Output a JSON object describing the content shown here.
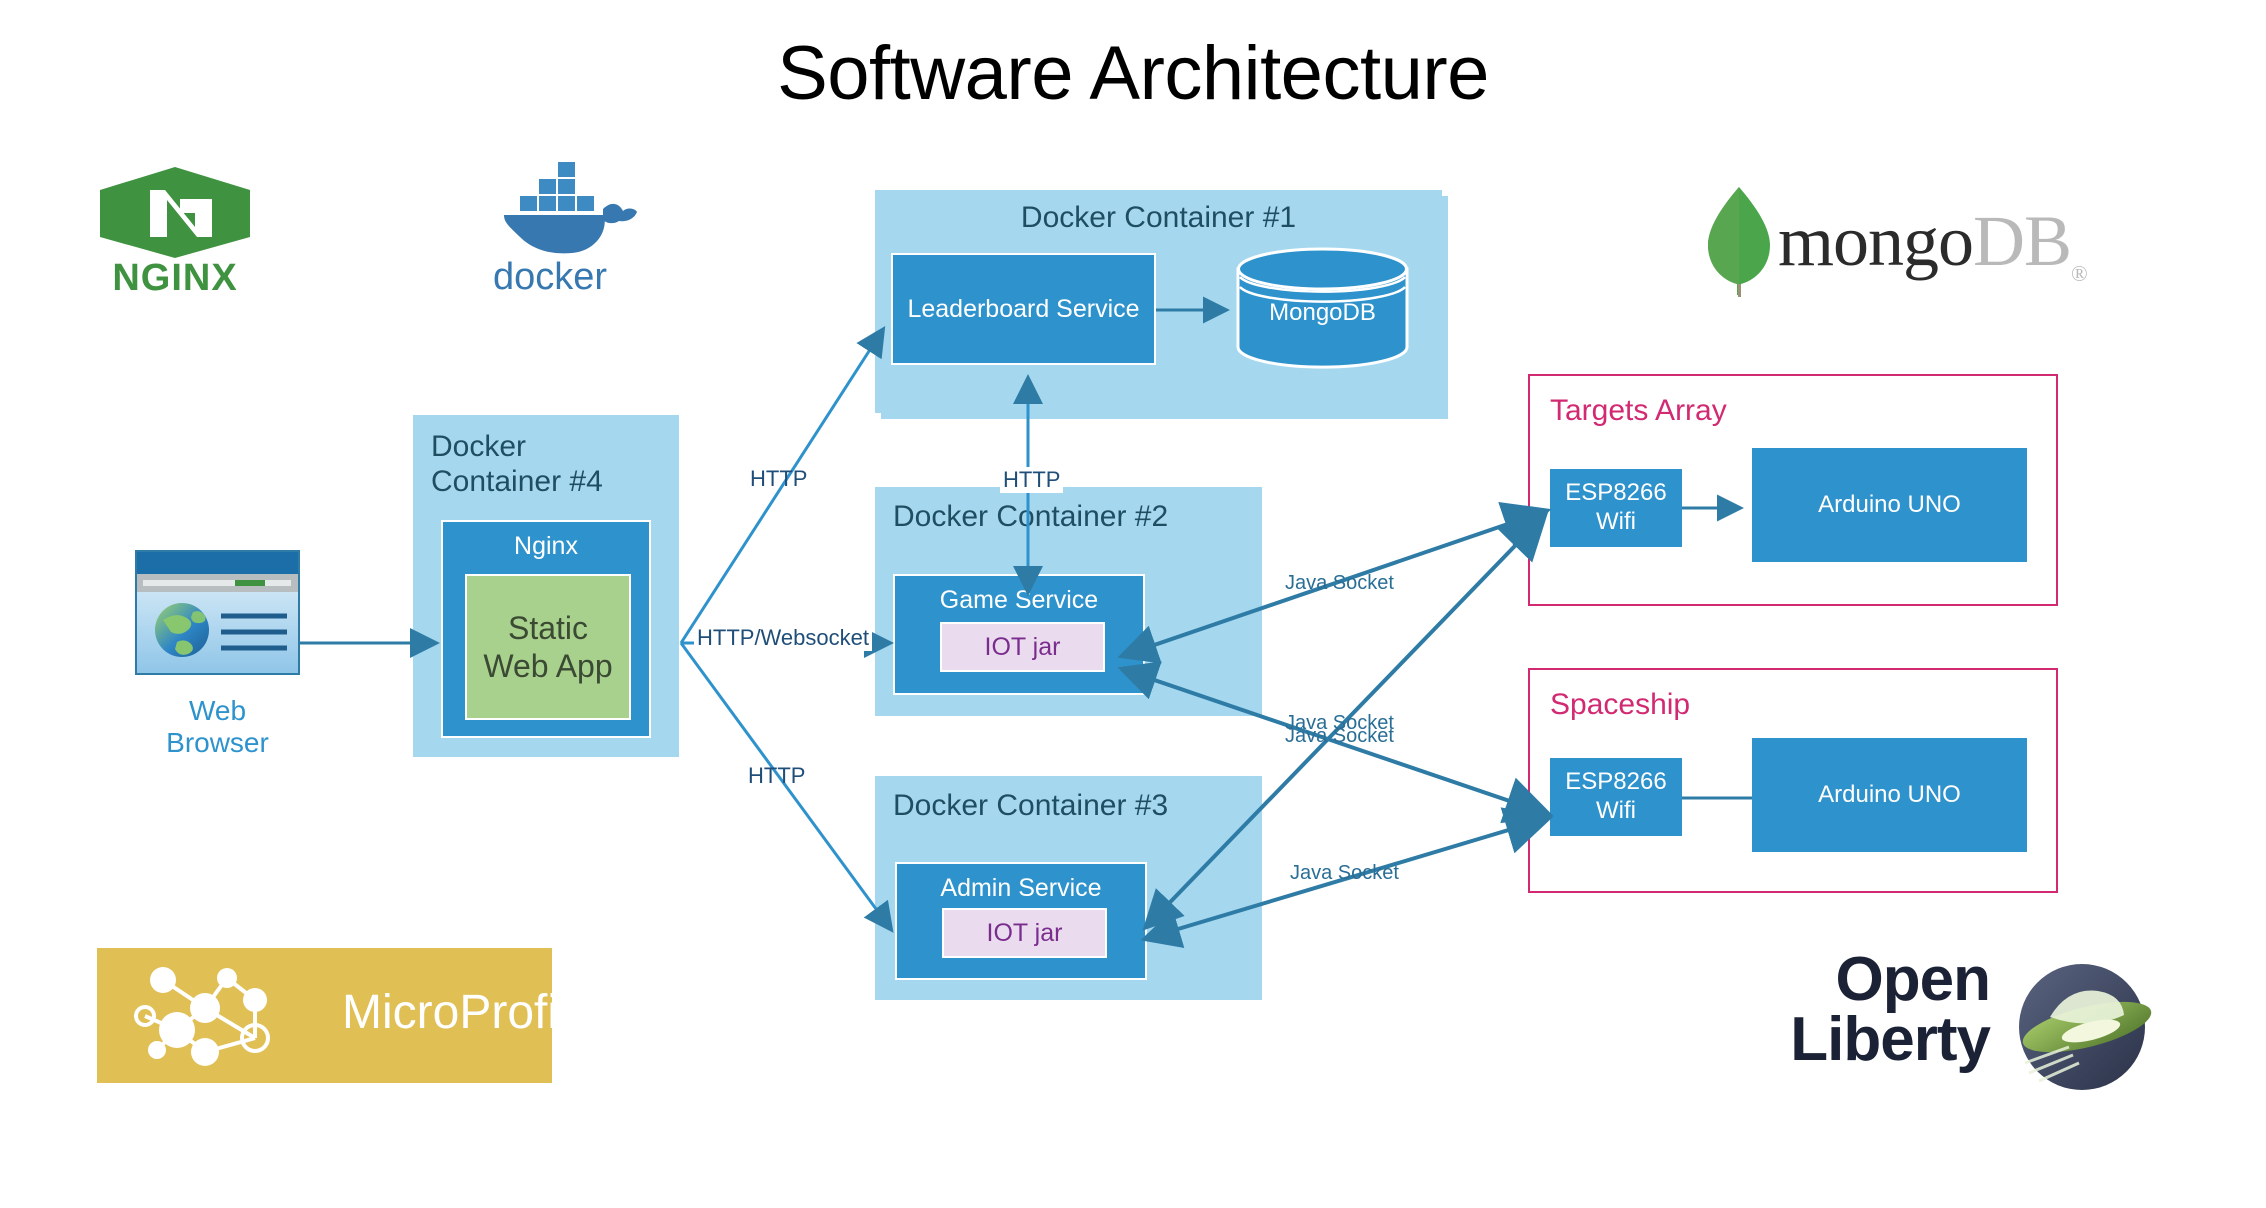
{
  "title": "Software Architecture",
  "logos": {
    "nginx": {
      "name": "NGINX",
      "wordmark": "NGINX",
      "color": "#3f9340"
    },
    "docker": {
      "name": "docker",
      "wordmark": "docker",
      "color": "#3878b0"
    },
    "mongodb": {
      "name": "mongoDB",
      "part1": "mongo",
      "part2": "DB",
      "registered": "®",
      "leaf_color": "#4ba64b"
    },
    "microprofile": {
      "name": "MicroProfile",
      "wordmark": "MicroProfile",
      "bg_color": "#e0bf54"
    },
    "openliberty": {
      "name": "Open Liberty",
      "line1": "Open",
      "line2": "Liberty",
      "text_color": "#1b2235",
      "accent_color": "#7ab648"
    }
  },
  "client": {
    "icon": "web-browser-icon",
    "caption": "Web Browser"
  },
  "containers": [
    {
      "id": "container4",
      "title": "Docker\nContainer #4",
      "title_line1": "Docker",
      "title_line2": "Container #4",
      "service": {
        "label": "Nginx",
        "inner": {
          "label_line1": "Static",
          "label_line2": "Web App",
          "color": "#a9d18e"
        }
      }
    },
    {
      "id": "container1",
      "title": "Docker Container #1",
      "service": {
        "label": "Leaderboard Service"
      },
      "database": {
        "label": "MongoDB",
        "shape": "cylinder"
      }
    },
    {
      "id": "container2",
      "title": "Docker Container #2",
      "service": {
        "label": "Game Service",
        "inner": {
          "label": "IOT jar"
        }
      }
    },
    {
      "id": "container3",
      "title": "Docker Container #3",
      "service": {
        "label": "Admin Service",
        "inner": {
          "label": "IOT jar"
        }
      }
    }
  ],
  "hardware_groups": [
    {
      "id": "targets-array",
      "title": "Targets Array",
      "nodes": [
        {
          "label_line1": "ESP8266",
          "label_line2": "Wifi"
        },
        {
          "label": "Arduino UNO"
        }
      ],
      "border_color": "#d22a72"
    },
    {
      "id": "spaceship",
      "title": "Spaceship",
      "nodes": [
        {
          "label_line1": "ESP8266",
          "label_line2": "Wifi"
        },
        {
          "label": "Arduino UNO"
        }
      ],
      "border_color": "#d22a72"
    }
  ],
  "edges": [
    {
      "id": "browser-to-nginx",
      "label": ""
    },
    {
      "id": "webapp-to-leaderboard",
      "label": "HTTP"
    },
    {
      "id": "webapp-to-game",
      "label": "HTTP/Websocket"
    },
    {
      "id": "webapp-to-admin",
      "label": "HTTP"
    },
    {
      "id": "leaderboard-game",
      "label": "HTTP"
    },
    {
      "id": "leaderboard-to-mongo",
      "label": ""
    },
    {
      "id": "game-to-targets",
      "label": "Java Socket"
    },
    {
      "id": "game-to-spaceship",
      "label": "Java Socket"
    },
    {
      "id": "admin-to-targets",
      "label": "Java Socket"
    },
    {
      "id": "admin-to-spaceship",
      "label": "Java Socket"
    }
  ],
  "colors": {
    "container_bg": "#a5d8ef",
    "service_bg": "#2e92cc",
    "iot_jar_bg": "#eadcee",
    "iot_jar_text": "#7b2d8e",
    "group_border": "#d22a72",
    "edge_stroke": "#2e7ca6",
    "title_text": "#1f4e62"
  }
}
